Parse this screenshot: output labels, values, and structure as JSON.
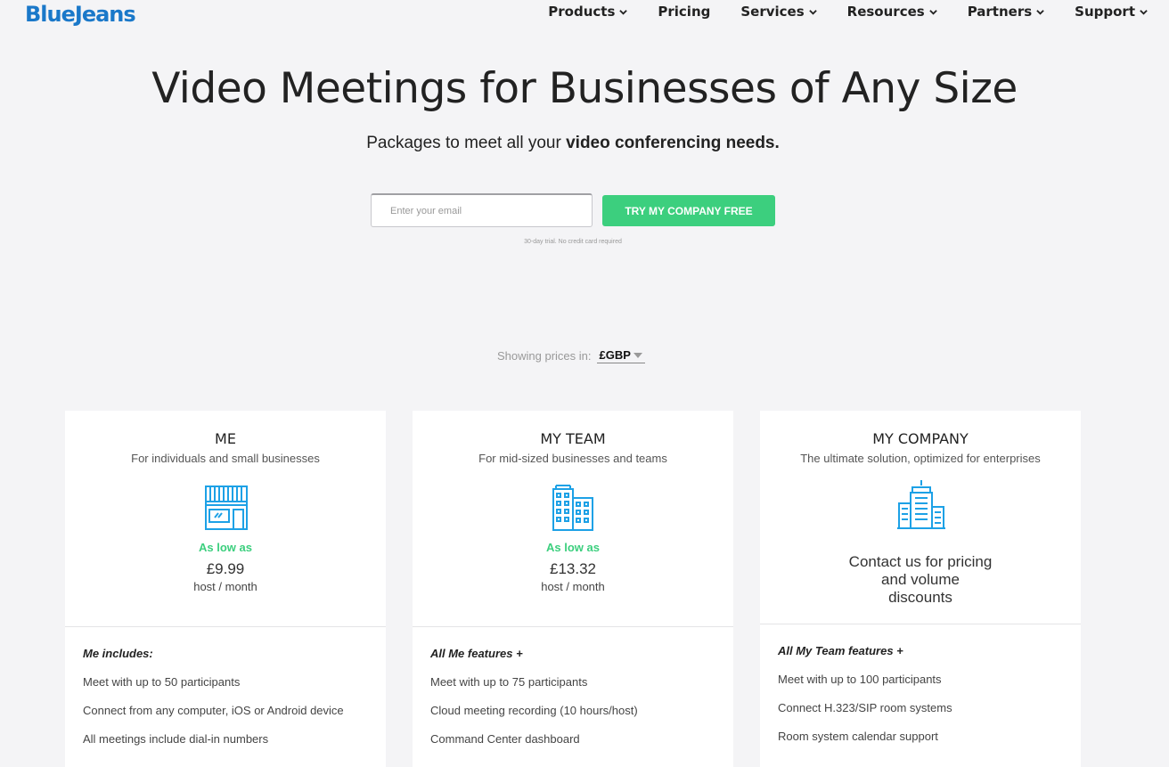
{
  "header": {
    "logo": "BlueJeans",
    "nav": [
      {
        "label": "Products",
        "has_dropdown": true
      },
      {
        "label": "Pricing",
        "has_dropdown": false
      },
      {
        "label": "Services",
        "has_dropdown": true
      },
      {
        "label": "Resources",
        "has_dropdown": true
      },
      {
        "label": "Partners",
        "has_dropdown": true
      },
      {
        "label": "Support",
        "has_dropdown": true
      }
    ]
  },
  "hero": {
    "title": "Video Meetings for Businesses of Any Size",
    "subtitle_start": "Packages to meet all your ",
    "subtitle_bold": "video conferencing needs.",
    "email_placeholder": "Enter your email",
    "email_value": "",
    "cta_label": "TRY MY COMPANY FREE",
    "trial_note": "30-day trial. No credit card required"
  },
  "currency": {
    "label": "Showing prices in:",
    "selected": "£GBP"
  },
  "colors": {
    "brand": "#1a78c9",
    "accent_green": "#3ccf7e",
    "icon_blue": "#1da1e6"
  },
  "plans": [
    {
      "title": "ME",
      "description": "For individuals and small businesses",
      "icon": "storefront-icon",
      "as_low_as": "As low as",
      "price": "£9.99",
      "per": "host / month",
      "features_heading": "Me includes:",
      "features": [
        "Meet with up to 50 participants",
        "Connect from any computer, iOS or Android device",
        "All meetings include dial-in numbers"
      ]
    },
    {
      "title": "MY TEAM",
      "description": "For mid-sized businesses and teams",
      "icon": "office-buildings-icon",
      "as_low_as": "As low as",
      "price": "£13.32",
      "per": "host / month",
      "features_heading": "All Me features +",
      "features": [
        "Meet with up to 75 participants",
        "Cloud meeting recording (10 hours/host)",
        "Command Center dashboard"
      ]
    },
    {
      "title": "MY COMPANY",
      "description": "The ultimate solution, optimized for enterprises",
      "icon": "skyscraper-icon",
      "contact_lines": [
        "Contact us for pricing",
        "and volume",
        "discounts"
      ],
      "features_heading": "All My Team features +",
      "features": [
        "Meet with up to 100 participants",
        "Connect H.323/SIP room systems",
        "Room system calendar support"
      ]
    }
  ]
}
